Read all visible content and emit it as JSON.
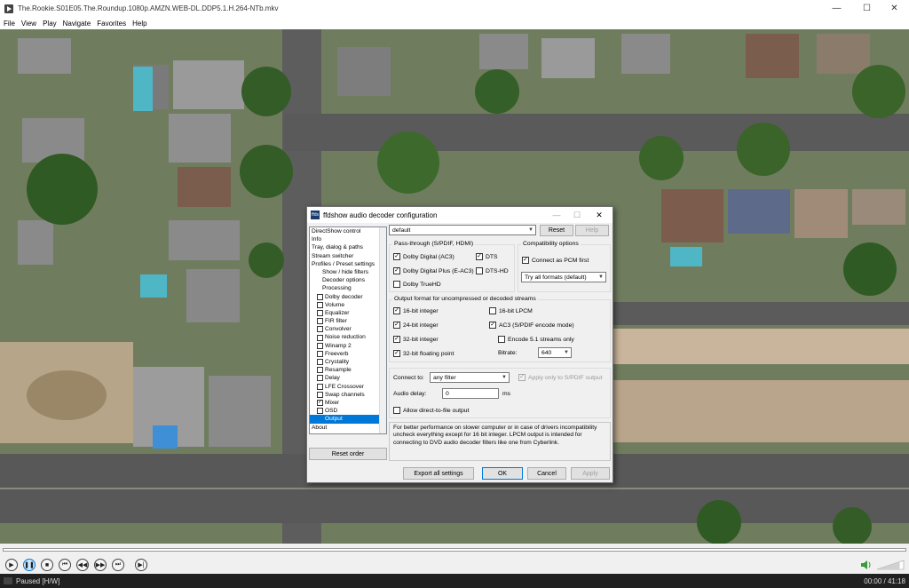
{
  "window": {
    "title": "The.Rookie.S01E05.The.Roundup.1080p.AMZN.WEB-DL.DDP5.1.H.264-NTb.mkv",
    "minimize": "—",
    "maximize": "☐",
    "close": "✕"
  },
  "menu": [
    "File",
    "View",
    "Play",
    "Navigate",
    "Favorites",
    "Help"
  ],
  "player": {
    "status": "Paused [H/W]",
    "time": "00:00 / 41:18",
    "volume_level": 0.85
  },
  "dialog": {
    "title": "ffdshow audio decoder configuration",
    "icon_text": "ffds",
    "preset": "default",
    "buttons": {
      "reset": "Reset",
      "help": "Help",
      "reset_order": "Reset order",
      "export": "Export all settings",
      "ok": "OK",
      "cancel": "Cancel",
      "apply": "Apply"
    },
    "tree": [
      {
        "label": "DirectShow control",
        "indent": 0,
        "check": null
      },
      {
        "label": "Info",
        "indent": 0,
        "check": null
      },
      {
        "label": "Tray, dialog & paths",
        "indent": 0,
        "check": null
      },
      {
        "label": "Stream switcher",
        "indent": 0,
        "check": null
      },
      {
        "label": "Profiles / Preset settings",
        "indent": 0,
        "check": null
      },
      {
        "label": "Show / hide filters",
        "indent": 2,
        "check": null
      },
      {
        "label": "Decoder options",
        "indent": 2,
        "check": null
      },
      {
        "label": "Processing",
        "indent": 2,
        "check": null
      },
      {
        "label": "Dolby decoder",
        "indent": 1,
        "check": false
      },
      {
        "label": "Volume",
        "indent": 1,
        "check": false
      },
      {
        "label": "Equalizer",
        "indent": 1,
        "check": false
      },
      {
        "label": "FIR filter",
        "indent": 1,
        "check": false
      },
      {
        "label": "Convolver",
        "indent": 1,
        "check": false
      },
      {
        "label": "Noise reduction",
        "indent": 1,
        "check": false
      },
      {
        "label": "Winamp 2",
        "indent": 1,
        "check": false
      },
      {
        "label": "Freeverb",
        "indent": 1,
        "check": false
      },
      {
        "label": "Crystality",
        "indent": 1,
        "check": false
      },
      {
        "label": "Resample",
        "indent": 1,
        "check": false
      },
      {
        "label": "Delay",
        "indent": 1,
        "check": false
      },
      {
        "label": "LFE Crossover",
        "indent": 1,
        "check": false
      },
      {
        "label": "Swap channels",
        "indent": 1,
        "check": false
      },
      {
        "label": "Mixer",
        "indent": 1,
        "check": true
      },
      {
        "label": "OSD",
        "indent": 1,
        "check": false
      },
      {
        "label": "Output",
        "indent": 1,
        "check": null,
        "selected": true
      },
      {
        "label": "About",
        "indent": 0,
        "check": null
      }
    ],
    "passthrough": {
      "title": "Pass-through (S/PDIF, HDMI)",
      "items": [
        {
          "label": "Dolby Digital (AC3)",
          "checked": true
        },
        {
          "label": "DTS",
          "checked": true
        },
        {
          "label": "Dolby Digital Plus (E-AC3)",
          "checked": true
        },
        {
          "label": "DTS-HD",
          "checked": false
        },
        {
          "label": "Dolby TrueHD",
          "checked": false
        }
      ]
    },
    "compat": {
      "title": "Compatibility options",
      "connect_pcm": "Connect as PCM first",
      "formats": "Try all formats (default)"
    },
    "output": {
      "title": "Output format for uncompressed or decoded streams",
      "int16": "16-bit integer",
      "lpcm16": "16-bit LPCM",
      "int24": "24-bit integer",
      "ac3": "AC3 (S/PDIF encode mode)",
      "int32": "32-bit integer",
      "encode51": "Encode 5.1 streams only",
      "float32": "32-bit floating point",
      "bitrate_label": "Bitrate:",
      "bitrate": "640"
    },
    "connect": {
      "label": "Connect to:",
      "value": "any filter",
      "spdif_only": "Apply only to S/PDIF output",
      "delay_label": "Audio delay:",
      "delay": "0",
      "delay_unit": "ms",
      "direct": "Allow direct-to-file output"
    },
    "description": "For better performance on slower computer or in case of drivers incompatibility uncheck everything except for 16 bit integer. LPCM output is intended for connecting to DVD audio decoder filters like one from Cyberlink."
  },
  "icons": {
    "app": "mpc-hc-icon",
    "annotation": "hand-drawn-ellipse"
  }
}
